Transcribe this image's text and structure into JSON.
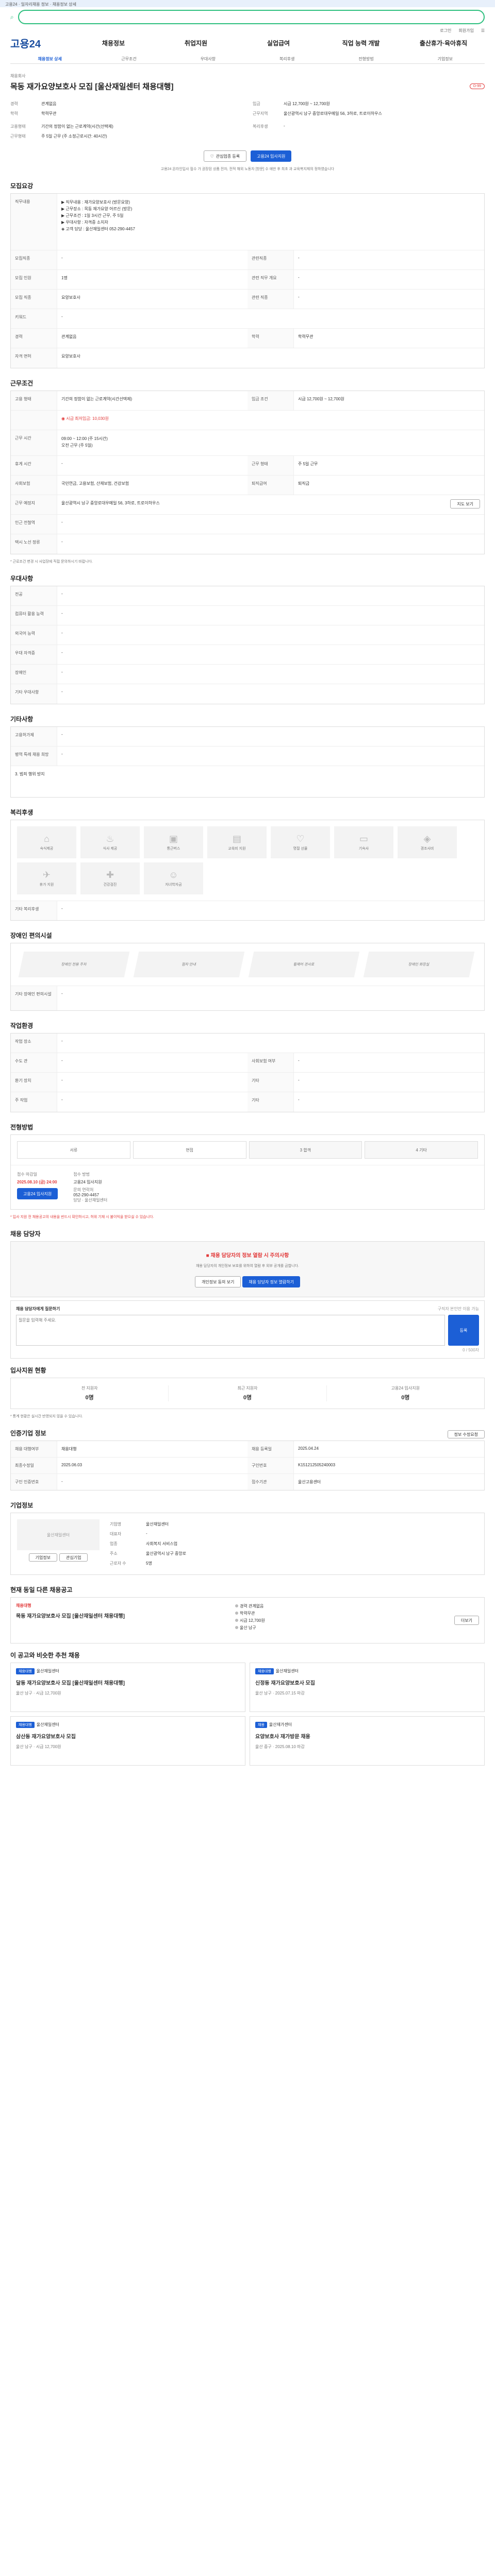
{
  "banner": {
    "text": "고용24 · 일자리채용 정보 · 채용정보 상세",
    "close": "닫기 ×"
  },
  "search": {
    "placeholder": ""
  },
  "util": {
    "login": "로그인",
    "join": "회원가입",
    "all": "전체메뉴"
  },
  "gnb": {
    "logo": "고용24",
    "menu": [
      "채용정보",
      "취업지원",
      "실업급여",
      "직업 능력 개발",
      "출산휴가·육아휴직"
    ]
  },
  "tabs": [
    "채용정보 상세",
    "근무조건",
    "우대사항",
    "복리후생",
    "전형방법",
    "기업정보"
  ],
  "job": {
    "company_label": "채용회사",
    "title": "목동 재가요양보호사 모집 [울산재일센터 채용대행]",
    "badge": "D-99",
    "rows": [
      {
        "k": "경력",
        "v": "관계없음"
      },
      {
        "k": "학력",
        "v": "학력무관"
      },
      {
        "k": "고용형태",
        "v": "기간의 정함이 없는 근로계약(시간(선택제)"
      },
      {
        "k": "근무형태",
        "v": "주 5일 근무 (주 소정근로시간: 40시간)"
      }
    ],
    "pay_k": "임금",
    "pay_v": "시급 12,700원 ~ 12,700원",
    "loc_k": "근무지역",
    "loc_v": "울산광역시 남구 중앙로대우메일 56, 3하로, 트로이하우스",
    "welfare_k": "복리후생",
    "welfare_v": "-",
    "save": "관심업종 등록",
    "apply": "고용24 입사지원",
    "note": "고용24 온라인입사 접수 가 권장된 상품 전자, 전적 해외 노동자 [방문] 수 에만 후 최초 과 교육복지제의 정하였습니다"
  },
  "recruit": {
    "h": "모집요강",
    "job_k": "직무내용",
    "job_v": "▶ 직무내용 : 재가요양보호사 (방문요양)\n▶ 근무장소 : 목동 재가요양 어르신 (방문)\n▶ 근무조건 : 1일 3시간 근무, 주 5일\n▶ 우대사항 : 자격증 소지자\n◈ 고객 담당 : 울산재일센터 052-290-4457",
    "rows": [
      {
        "k": "모집직종",
        "v": "-",
        "k2": "관련직종",
        "v2": "-"
      },
      {
        "k": "모집 인원",
        "v": "1명",
        "k2": "관련 직무 개요",
        "v2": "-"
      },
      {
        "k": "모집 직종",
        "v": "요양보호사",
        "k2": "관련 직종",
        "v2": "-"
      },
      {
        "k": "키워드",
        "v": "-",
        "k2": "",
        "v2": ""
      },
      {
        "k": "경력",
        "v": "관계없음",
        "k2": "학력",
        "v2": "학력무관"
      },
      {
        "k": "자격 면허",
        "v": "요양보호사",
        "k2": "",
        "v2": ""
      }
    ]
  },
  "cond": {
    "h": "근무조건",
    "rows": [
      {
        "k": "고용 형태",
        "v": "기간의 정함이 없는 근로계약(시간선택제)",
        "k2": "임금 조건",
        "v2": "시급 12,700원 ~ 12,700원"
      },
      {
        "k": "",
        "v": "◉ 시급 최저임금: 10,030원",
        "k2": "",
        "v2": ""
      },
      {
        "k": "근무 시간",
        "v": "09:00 ~ 12:00 (주 15시간)\n오전 근무 (주 5일)",
        "k2": "",
        "v2": ""
      },
      {
        "k": "휴게 시간",
        "v": "-",
        "k2": "근무 형태",
        "v2": "주 5일 근무"
      },
      {
        "k": "사회보험",
        "v": "국민연금, 고용보험, 산재보험, 건강보험",
        "k2": "퇴직급여",
        "v2": "퇴직금"
      },
      {
        "k": "근무 예정지",
        "v": "울산광역시 남구 중앙로대우메일 56, 3하로, 트로이하우스",
        "k2": "",
        "v2": ""
      },
      {
        "k": "인근 전철역",
        "v": "-",
        "k2": "",
        "v2": ""
      },
      {
        "k": "택시 노선 정류",
        "v": "-",
        "k2": "",
        "v2": ""
      }
    ],
    "map": "지도 보기",
    "note": "* 근로조건 변경 시 사업장에 직접 문의하시기 바랍니다."
  },
  "pref": {
    "h": "우대사항",
    "rows": [
      {
        "k": "전공",
        "v": "-"
      },
      {
        "k": "컴퓨터 활용 능력",
        "v": "-"
      },
      {
        "k": "외국어 능력",
        "v": "-"
      },
      {
        "k": "우대 자격증",
        "v": "-"
      },
      {
        "k": "장애인",
        "v": "-"
      },
      {
        "k": "기타 우대사항",
        "v": "-"
      }
    ]
  },
  "etc": {
    "h": "기타사항",
    "rows": [
      {
        "k": "고용허가제",
        "v": "-"
      },
      {
        "k": "병역 특례 채용 희망",
        "v": "-"
      }
    ],
    "note": "3. 범죄 행위 방지"
  },
  "welfare": {
    "h": "복리후생",
    "items": [
      "숙식제공",
      "식사 제공",
      "통근버스",
      "교육비 지원",
      "명절 선물",
      "기숙사",
      "경조사비",
      "휴가 지원",
      "건강검진",
      "자녀학자금"
    ],
    "other_k": "기타 복리후생",
    "other_v": "-"
  },
  "disab": {
    "h": "장애인 편의시설",
    "items": [
      "장애인 전용 주차",
      "점자 안내",
      "휠체어 경사로",
      "장애인 화장실"
    ],
    "other_k": "기타 장애인 편의시설",
    "other_v": "-"
  },
  "work": {
    "h": "작업환경",
    "rows": [
      {
        "k": "작업 장소",
        "v": "-",
        "k2": "",
        "v2": ""
      },
      {
        "k": "수도 관",
        "v": "-",
        "k2": "사회보험 여부",
        "v2": "-"
      },
      {
        "k": "환기 장치",
        "v": "-",
        "k2": "기타",
        "v2": "-"
      },
      {
        "k": "주 작업",
        "v": "-",
        "k2": "기타",
        "v2": "-"
      }
    ]
  },
  "process": {
    "h": "전형방법",
    "steps": [
      "서류",
      "면접",
      "3 합격",
      "4 기타"
    ],
    "deadline_k": "접수 마감일",
    "deadline_v": "2025.08.10 (금) 24:00",
    "method_k": "접수 방법",
    "method_v": "고용24 입사지원",
    "contact_k": "문의 연락처",
    "contact_v": "052-290-4457",
    "contact_name": "담당 · 울산재일센터",
    "apply": "고용24 입사지원",
    "note": "* 입사 지원 전 채용공고의 내용을 반드시 확인하시고, 허위 기재 시 불이익을 받으실 수 있습니다."
  },
  "contact": {
    "h": "채용 담당자",
    "alert": "채용 담당자의 정보 열람 시 주의사항",
    "desc": "채용 담당자의 개인정보 보호를 위하여 열람 후 외부 공개를 금합니다.",
    "b1": "개인정보 동의 보기",
    "b2": "채용 담당자 정보 열람하기",
    "q_label": "채용 담당자에게 질문하기",
    "q_note": "구직자 본인만 이용 가능",
    "q_placeholder": "질문을 입력해 주세요.",
    "q_count": "0 / 500자",
    "q_btn": "등록"
  },
  "stats": {
    "h": "입사지원 현황",
    "items": [
      {
        "k": "전 지원자",
        "v": "0명"
      },
      {
        "k": "최근 지원자",
        "v": "0명"
      },
      {
        "k": "고용24 입사지원",
        "v": "0명"
      }
    ],
    "note": "* 통계 현황은 실시간 반영되지 않을 수 있습니다."
  },
  "info": {
    "h": "인증기업 정보",
    "rows": [
      {
        "k": "채용 대행여부",
        "v": "채용대행",
        "k2": "채용 등록일",
        "v2": "2025.04.24"
      },
      {
        "k": "최종수정일",
        "v": "2025.06.03",
        "k2": "구인번호",
        "v2": "K151212505240003"
      },
      {
        "k": "구인 인증번호",
        "v": "-",
        "k2": "접수기관",
        "v2": "울산고용센터"
      }
    ],
    "edit": "정보 수정요청"
  },
  "company": {
    "h": "기업정보",
    "name": "울산재일센터",
    "rows": [
      {
        "k": "기업명",
        "v": "울산재일센터"
      },
      {
        "k": "대표자",
        "v": "-"
      },
      {
        "k": "업종",
        "v": "사회복지 서비스업"
      },
      {
        "k": "주소",
        "v": "울산광역시 남구 중앙로"
      },
      {
        "k": "근로자 수",
        "v": "5명"
      }
    ],
    "b1": "기업정보",
    "b2": "관심기업"
  },
  "same": {
    "h": "현재 동일 다른 채용공고",
    "badge": "채용대행",
    "title": "목동 재가요양보호사 모집 [울산재일센터 채용대행]",
    "meta": [
      "경력 관계없음",
      "학력무관",
      "시급 12,700원",
      "울산 남구"
    ],
    "more": "더보기"
  },
  "rec": {
    "h": "이 공고와 비슷한 추천 채용",
    "items": [
      {
        "badge": "채용대행",
        "co": "울산재일센터",
        "title": "달동 재가요양보호사 모집 [울산재일센터 채용대행]",
        "meta": "울산 남구 · 시급 12,700원"
      },
      {
        "badge": "채용대행",
        "co": "울산재일센터",
        "title": "신정동 재가요양보호사 모집",
        "meta": "울산 남구 · 2025.07.15 마감"
      },
      {
        "badge": "채용대행",
        "co": "울산재일센터",
        "title": "삼산동 재가요양보호사 모집",
        "meta": "울산 남구 · 시급 12,700원"
      },
      {
        "badge": "채용",
        "co": "울산재가센터",
        "title": "요양보호사 재가방문 채용",
        "meta": "울산 중구 · 2025.08.10 마감"
      }
    ]
  }
}
